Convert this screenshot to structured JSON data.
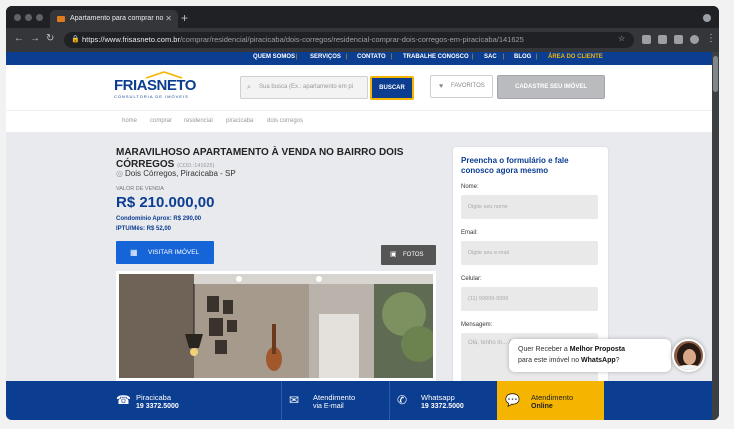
{
  "browser": {
    "tab_title": "Apartamento para comprar no",
    "url_host": "https://www.frisasneto.com.br",
    "url_path": "/comprar/residencial/piracicaba/dois-corregos/residencial-comprar-dois-corregos-em-piracicaba/141625"
  },
  "topnav": {
    "items": [
      "QUEM SOMOS",
      "SERVIÇOS",
      "CONTATO",
      "TRABALHE CONOSCO",
      "SAC",
      "BLOG",
      "ÁREA DO CLIENTE"
    ]
  },
  "header": {
    "logo_text": "FRIASNETO",
    "logo_tagline": "CONSULTORIA DE IMÓVEIS",
    "search_placeholder": "Sua busca (Ex.: apartamento em pi",
    "search_button": "BUSCAR",
    "favorites_button": "FAVORITOS",
    "register_button": "CADASTRE SEU IMÓVEL"
  },
  "breadcrumb": [
    "home",
    "comprar",
    "residencial",
    "piracicaba",
    "dois corregos"
  ],
  "listing": {
    "title": "MARAVILHOSO APARTAMENTO À VENDA NO BAIRRO DOIS CÓRREGOS",
    "code": "(COD.:141625)",
    "location": "Dois Córregos, Piracicaba - SP",
    "price_label": "VALOR DE VENDA",
    "price": "R$ 210.000,00",
    "condo": "Condomínio Aprox: R$ 290,00",
    "iptu": "IPTU/Mês: R$ 52,00",
    "visit_button": "VISITAR IMÓVEL",
    "photos_button": "FOTOS"
  },
  "form": {
    "heading": "Preencha o formulário e fale conosco agora mesmo",
    "name_label": "Nome:",
    "name_placeholder": "Digite seu nome",
    "email_label": "Email:",
    "email_placeholder": "Digite seu e-mail",
    "phone_label": "Celular:",
    "phone_placeholder": "(11) 99999-9999",
    "message_label": "Mensagem:",
    "message_placeholder": "Olá, tenho in... Aguardo o c..."
  },
  "chat": {
    "line1_prefix": "Quer Receber a ",
    "line1_bold": "Melhor Proposta",
    "line2_prefix": "para este imóvel no ",
    "line2_bold": "WhatsApp",
    "line2_suffix": "?"
  },
  "footer": [
    {
      "title": "Piracicaba",
      "value": "19 3372.5000",
      "icon": "phone-icon"
    },
    {
      "title": "Atendimento",
      "value": "via E-mail",
      "icon": "mail-icon"
    },
    {
      "title": "Whatsapp",
      "value": "19 3372.5000",
      "icon": "whatsapp-icon"
    },
    {
      "title": "Atendimento",
      "value": "Online",
      "icon": "chat-icon"
    }
  ],
  "colors": {
    "brand_blue": "#0b3d91",
    "accent_yellow": "#f5b400",
    "button_blue": "#1565d8"
  }
}
